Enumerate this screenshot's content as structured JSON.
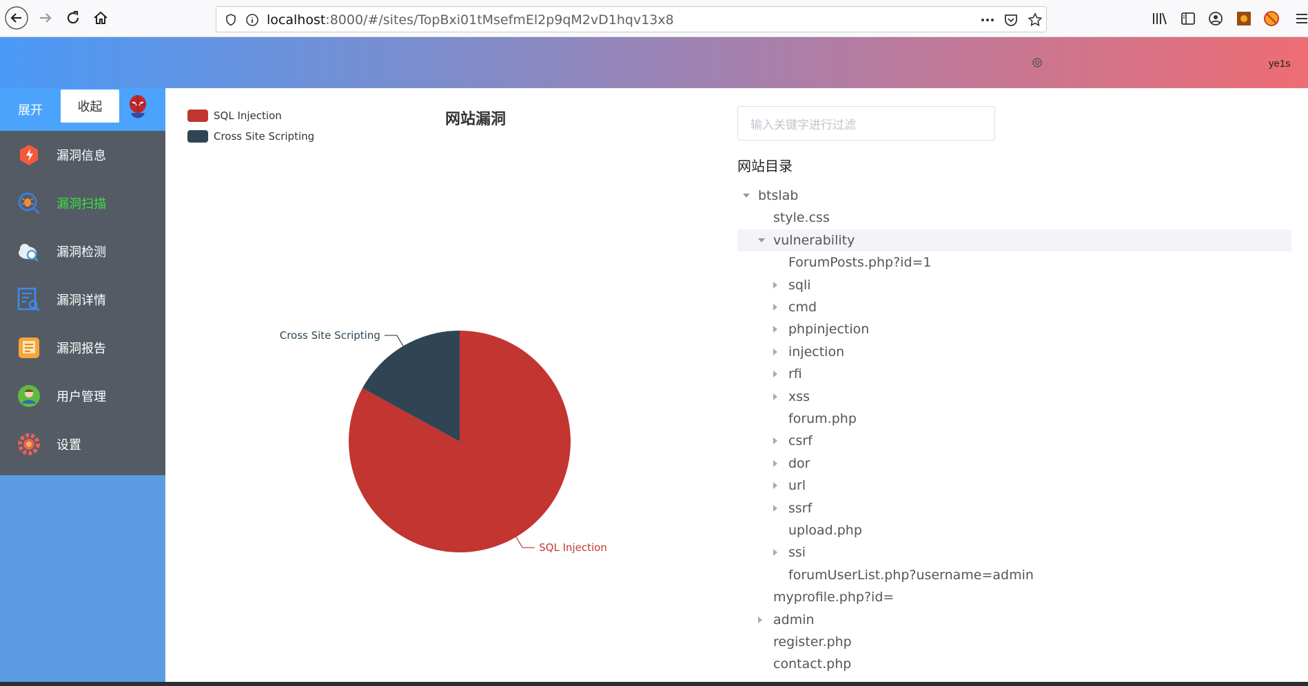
{
  "browser": {
    "url_host": "localhost",
    "url_path": ":8000/#/sites/TopBxi01tMsefmEl2p9qM2vD1hqv13x8"
  },
  "header": {
    "username": "ye1s"
  },
  "sidebar": {
    "expand_label": "展开",
    "collapse_label": "收起",
    "items": [
      {
        "label": "漏洞信息",
        "icon": "shield-bolt-icon",
        "color": "#f35a3c"
      },
      {
        "label": "漏洞扫描",
        "icon": "bug-search-icon",
        "color": "#3ce045",
        "active": true
      },
      {
        "label": "漏洞检测",
        "icon": "cloud-search-icon",
        "color": "#ffffff"
      },
      {
        "label": "漏洞详情",
        "icon": "document-search-icon",
        "color": "#3b8cf0"
      },
      {
        "label": "漏洞报告",
        "icon": "report-icon",
        "color": "#f6a53a"
      },
      {
        "label": "用户管理",
        "icon": "user-icon",
        "color": "#5fb944"
      },
      {
        "label": "设置",
        "icon": "gear-icon",
        "color": "#e8605a"
      }
    ]
  },
  "chart_data": {
    "type": "pie",
    "title": "网站漏洞",
    "legend_position": "top-left",
    "series": [
      {
        "name": "SQL Injection",
        "value": 83,
        "color": "#c23531"
      },
      {
        "name": "Cross Site Scripting",
        "value": 17,
        "color": "#2f4554"
      }
    ]
  },
  "tree_panel": {
    "filter_placeholder": "输入关键字进行过滤",
    "heading": "网站目录",
    "nodes": [
      {
        "label": "btslab",
        "level": 0,
        "caret": "down"
      },
      {
        "label": "style.css",
        "level": 1,
        "caret": "none"
      },
      {
        "label": "vulnerability",
        "level": 1,
        "caret": "down",
        "highlight": true
      },
      {
        "label": "ForumPosts.php?id=1",
        "level": 2,
        "caret": "none"
      },
      {
        "label": "sqli",
        "level": 2,
        "caret": "right"
      },
      {
        "label": "cmd",
        "level": 2,
        "caret": "right"
      },
      {
        "label": "phpinjection",
        "level": 2,
        "caret": "right"
      },
      {
        "label": "injection",
        "level": 2,
        "caret": "right"
      },
      {
        "label": "rfi",
        "level": 2,
        "caret": "right"
      },
      {
        "label": "xss",
        "level": 2,
        "caret": "right"
      },
      {
        "label": "forum.php",
        "level": 2,
        "caret": "none"
      },
      {
        "label": "csrf",
        "level": 2,
        "caret": "right"
      },
      {
        "label": "dor",
        "level": 2,
        "caret": "right"
      },
      {
        "label": "url",
        "level": 2,
        "caret": "right"
      },
      {
        "label": "ssrf",
        "level": 2,
        "caret": "right"
      },
      {
        "label": "upload.php",
        "level": 2,
        "caret": "none"
      },
      {
        "label": "ssi",
        "level": 2,
        "caret": "right"
      },
      {
        "label": "forumUserList.php?username=admin",
        "level": 2,
        "caret": "none"
      },
      {
        "label": "myprofile.php?id=",
        "level": 1,
        "caret": "none"
      },
      {
        "label": "admin",
        "level": 1,
        "caret": "right"
      },
      {
        "label": "register.php",
        "level": 1,
        "caret": "none"
      },
      {
        "label": "contact.php",
        "level": 1,
        "caret": "none"
      }
    ]
  }
}
